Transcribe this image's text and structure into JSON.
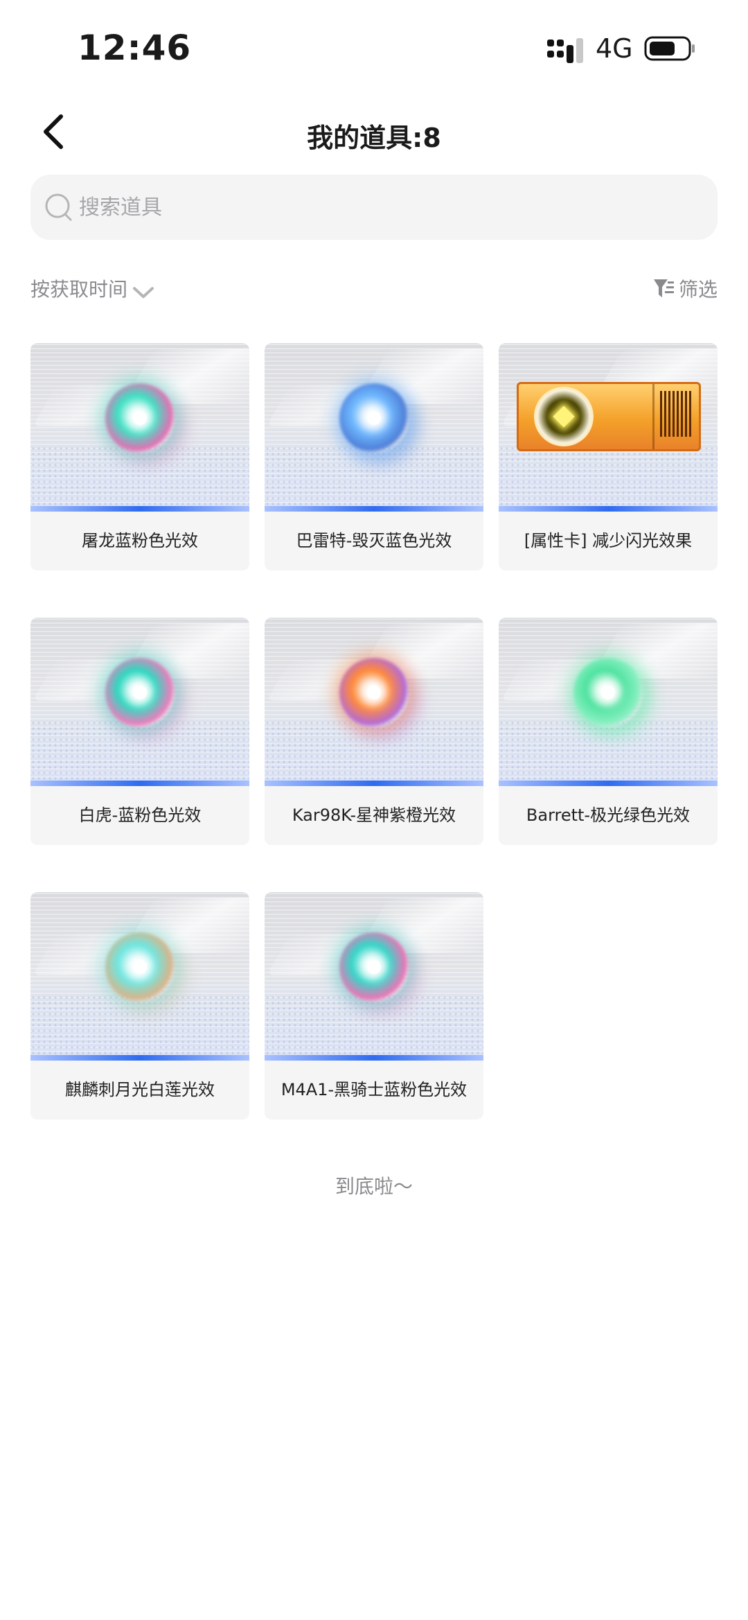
{
  "status": {
    "time": "12:46",
    "network": "4G",
    "icons": [
      "signal-icon",
      "battery-icon"
    ]
  },
  "nav": {
    "title": "我的道具:8",
    "back_icon": "chevron-left-icon"
  },
  "search": {
    "placeholder": "搜索道具",
    "value": ""
  },
  "sort": {
    "label": "按获取时间",
    "icon": "chevron-down-icon"
  },
  "filter": {
    "label": "筛选",
    "icon": "filter-icon"
  },
  "items": [
    {
      "label": "屠龙蓝粉色光效",
      "kind": "orb",
      "colors": [
        "#3fe0c4",
        "#e46fb3"
      ]
    },
    {
      "label": "巴雷特-毁灭蓝色光效",
      "kind": "orb",
      "colors": [
        "#6fb8ff",
        "#4f7fd8"
      ]
    },
    {
      "label": "[属性卡] 减少闪光效果",
      "kind": "ticket",
      "colors": [
        "#f4a12a",
        "#fff37a"
      ]
    },
    {
      "label": "白虎-蓝粉色光效",
      "kind": "orb",
      "colors": [
        "#2fd8c0",
        "#ee7cbc"
      ]
    },
    {
      "label": "Kar98K-星神紫橙光效",
      "kind": "orb",
      "colors": [
        "#ff8a3a",
        "#b46ad8"
      ]
    },
    {
      "label": "Barrett-极光绿色光效",
      "kind": "orb",
      "colors": [
        "#4fe3a0",
        "#8ef0c4"
      ]
    },
    {
      "label": "麒麟刺月光白莲光效",
      "kind": "orb",
      "colors": [
        "#6fe6e0",
        "#d8b48a"
      ]
    },
    {
      "label": "M4A1-黑骑士蓝粉色光效",
      "kind": "orb",
      "colors": [
        "#35d6c8",
        "#ec74b6"
      ]
    }
  ],
  "footer": {
    "end_text": "到底啦～"
  }
}
